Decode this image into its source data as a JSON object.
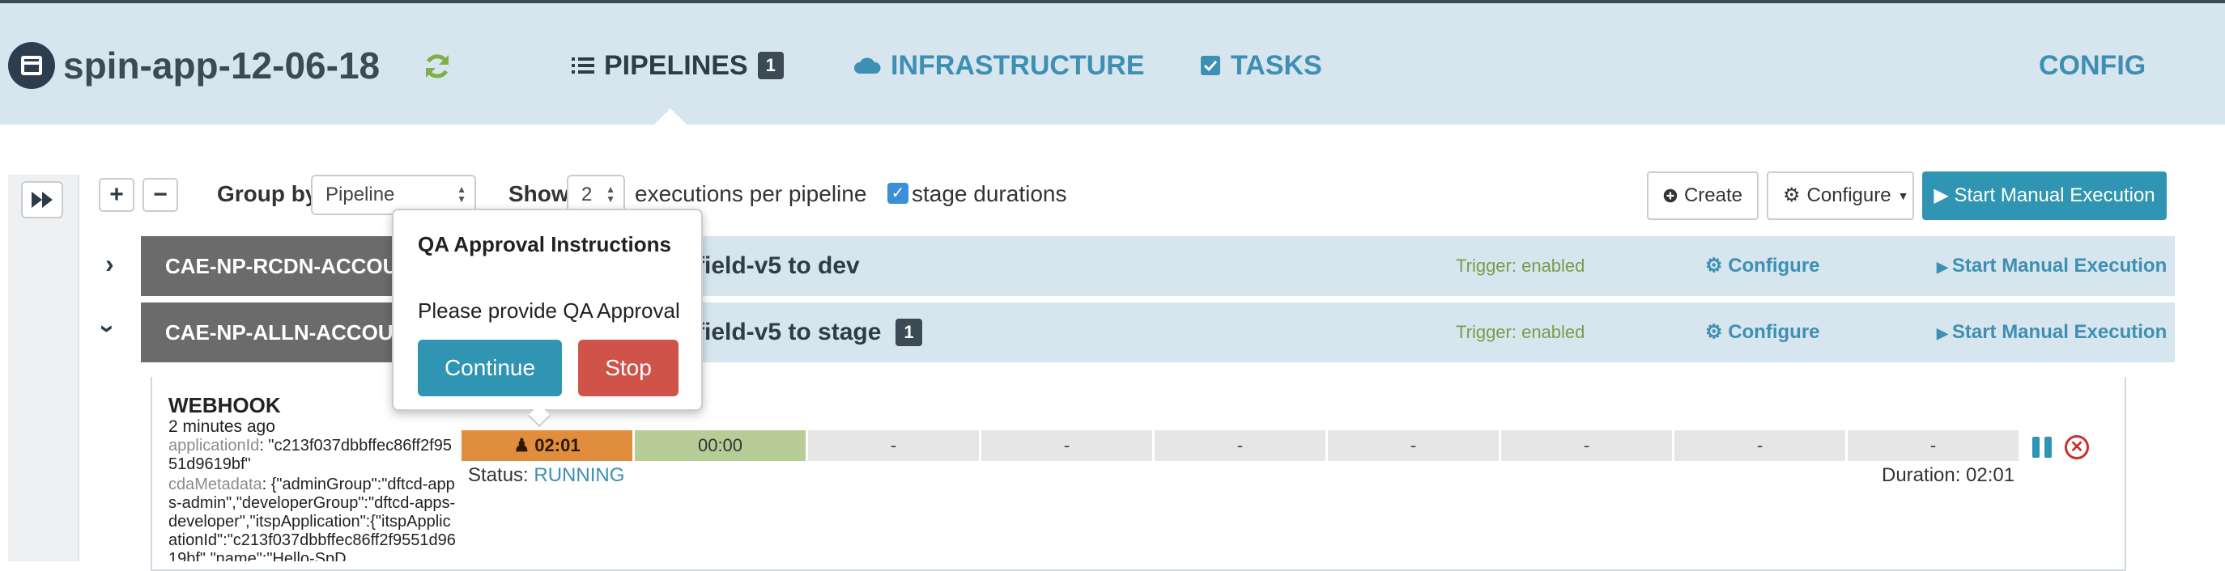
{
  "header": {
    "app_title": "spin-app-12-06-18",
    "nav": {
      "pipelines_label": "PIPELINES",
      "pipelines_count": "1",
      "infrastructure_label": "INFRASTRUCTURE",
      "tasks_label": "TASKS",
      "config_label": "CONFIG"
    }
  },
  "controls": {
    "expand_all": "+",
    "collapse_all": "−",
    "group_by_label": "Group by",
    "group_by_value": "Pipeline",
    "show_label": "Show",
    "show_value": "2",
    "executions_label": "executions per pipeline",
    "stage_durations_label": "stage durations",
    "create_label": "Create",
    "configure_label": "Configure",
    "start_manual_label": "Start Manual Execution"
  },
  "pipelines": [
    {
      "name": "CAE-NP-RCDN-ACCOUNT",
      "rest_name": "field-v5 to dev",
      "trigger": "Trigger: enabled",
      "configure": "Configure",
      "start_manual": "Start Manual Execution"
    },
    {
      "name": "CAE-NP-ALLN-ACCOUNT",
      "rest_name": "field-v5 to stage",
      "count": "1",
      "trigger": "Trigger: enabled",
      "configure": "Configure",
      "start_manual": "Start Manual Execution"
    }
  ],
  "execution": {
    "trigger_type": "WEBHOOK",
    "time_ago": "2 minutes ago",
    "param1_key": "applicationId",
    "param1_value": ": \"c213f037dbbffec86ff2f9551d9619bf\"",
    "param2_key": "cdaMetadata",
    "param2_value": ": {\"adminGroup\":\"dftcd-apps-admin\",\"developerGroup\":\"dftcd-apps-developer\",\"itspApplication\":{\"itspApplicationId\":\"c213f037dbbffec86ff2f9551d9619bf\",\"name\":\"Hello-SpD",
    "stages": [
      "02:01",
      "00:00",
      "-",
      "-",
      "-",
      "-",
      "-",
      "-",
      "-"
    ],
    "status_label": "Status: ",
    "status_value": "RUNNING",
    "duration": "Duration: 02:01"
  },
  "popover": {
    "title": "QA Approval Instructions",
    "text": "Please provide QA Approval",
    "continue_label": "Continue",
    "stop_label": "Stop"
  },
  "colors": {
    "header_bg": "#d7e6ee",
    "accent": "#3d8fb3",
    "primary_button": "#2f95b3",
    "stop_button": "#d0534a",
    "running_stage": "#e08e3d",
    "complete_stage": "#b8cc98"
  }
}
